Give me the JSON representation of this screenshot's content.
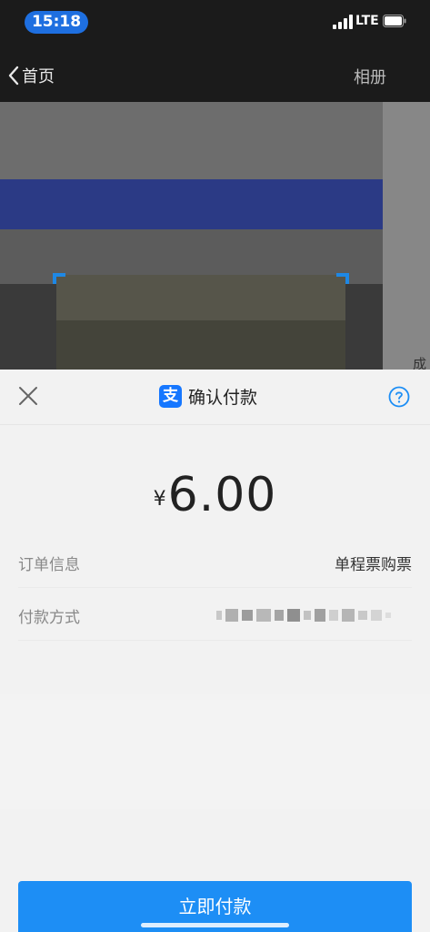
{
  "status_bar": {
    "time": "15:18",
    "network": "LTE",
    "icons": [
      "signal-icon",
      "battery-icon"
    ]
  },
  "nav": {
    "back_label": "首页",
    "album_label": "相册",
    "back_icon": "chevron-left-icon"
  },
  "background": {
    "side_char": "成"
  },
  "sheet": {
    "title": "确认付款",
    "logo_char": "支",
    "close_icon": "close-icon",
    "help_icon": "help-icon",
    "currency": "¥",
    "amount": "6.00",
    "order_label": "订单信息",
    "order_value": "单程票购票",
    "method_label": "付款方式",
    "pay_button": "立即付款"
  },
  "colors": {
    "accent": "#1d8ef5",
    "logo": "#1677ff",
    "time_pill": "#1e6fe0"
  }
}
